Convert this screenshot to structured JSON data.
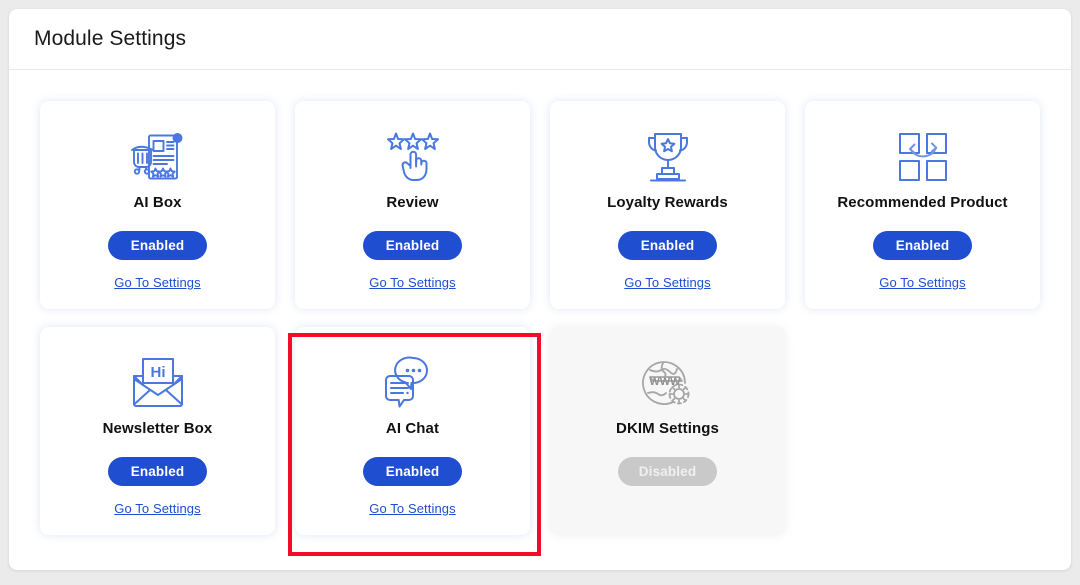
{
  "header": {
    "title": "Module Settings"
  },
  "labels": {
    "enabled": "Enabled",
    "disabled": "Disabled",
    "go_to_settings": "Go To Settings"
  },
  "colors": {
    "page_background": "#ebebeb",
    "panel_background": "#ffffff",
    "accent_blue": "#1f4fd0",
    "icon_blue": "#4a78de",
    "disabled_gray": "#c9c9c9",
    "disabled_card_background": "#f7f7f7",
    "highlight_red": "#f50b2a"
  },
  "modules": [
    {
      "name": "AI Box",
      "icon": "ai-box-icon",
      "status": "Enabled",
      "enabled": true,
      "link": "Go To Settings",
      "has_link": true,
      "highlighted": false
    },
    {
      "name": "Review",
      "icon": "review-stars-hand-icon",
      "status": "Enabled",
      "enabled": true,
      "link": "Go To Settings",
      "has_link": true,
      "highlighted": false
    },
    {
      "name": "Loyalty Rewards",
      "icon": "trophy-icon",
      "status": "Enabled",
      "enabled": true,
      "link": "Go To Settings",
      "has_link": true,
      "highlighted": false
    },
    {
      "name": "Recommended Product",
      "icon": "recommended-product-icon",
      "status": "Enabled",
      "enabled": true,
      "link": "Go To Settings",
      "has_link": true,
      "highlighted": false
    },
    {
      "name": "Newsletter Box",
      "icon": "envelope-hi-icon",
      "status": "Enabled",
      "enabled": true,
      "link": "Go To Settings",
      "has_link": true,
      "highlighted": false
    },
    {
      "name": "AI Chat",
      "icon": "chat-bubbles-icon",
      "status": "Enabled",
      "enabled": true,
      "link": "Go To Settings",
      "has_link": true,
      "highlighted": true
    },
    {
      "name": "DKIM Settings",
      "icon": "globe-www-gear-icon",
      "status": "Disabled",
      "enabled": false,
      "link": "",
      "has_link": false,
      "highlighted": false
    }
  ]
}
